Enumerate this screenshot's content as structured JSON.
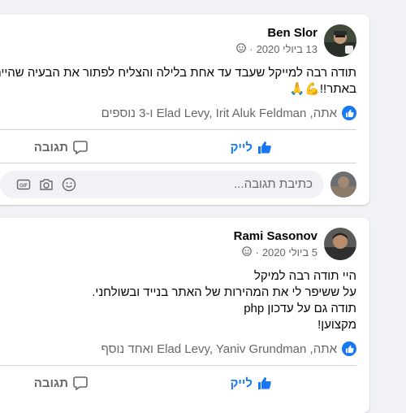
{
  "posts": [
    {
      "author": "Ben Slor",
      "date": "13 ביולי 2020",
      "audience_icon": "friends-icon",
      "lines": [
        "תודה רבה למייקל שעבד עד אחת בלילה והצליח לפתור את הבעיה שהייתה לנו",
        "באתר!!💪🙏"
      ],
      "reactions_text": "אתה, Elad Levy, Irit Aluk Feldman ו-3 נוספים",
      "like_label": "לייק",
      "comment_label": "תגובה",
      "comment_placeholder": "כתיבת תגובה...",
      "accent": "#1877f2"
    },
    {
      "author": "Rami Sasonov",
      "date": "5 ביולי 2020",
      "audience_icon": "friends-icon",
      "lines": [
        "היי תודה רבה למיקל",
        "על ששיפר לי את המהירות של האתר בנייד ובשולחני.",
        "תודה גם על עדכון php",
        "מקצוען!"
      ],
      "reactions_text": "אתה, Elad Levy, Yaniv Grundman ואחד נוסף",
      "like_label": "לייק",
      "comment_label": "תגובה"
    }
  ]
}
